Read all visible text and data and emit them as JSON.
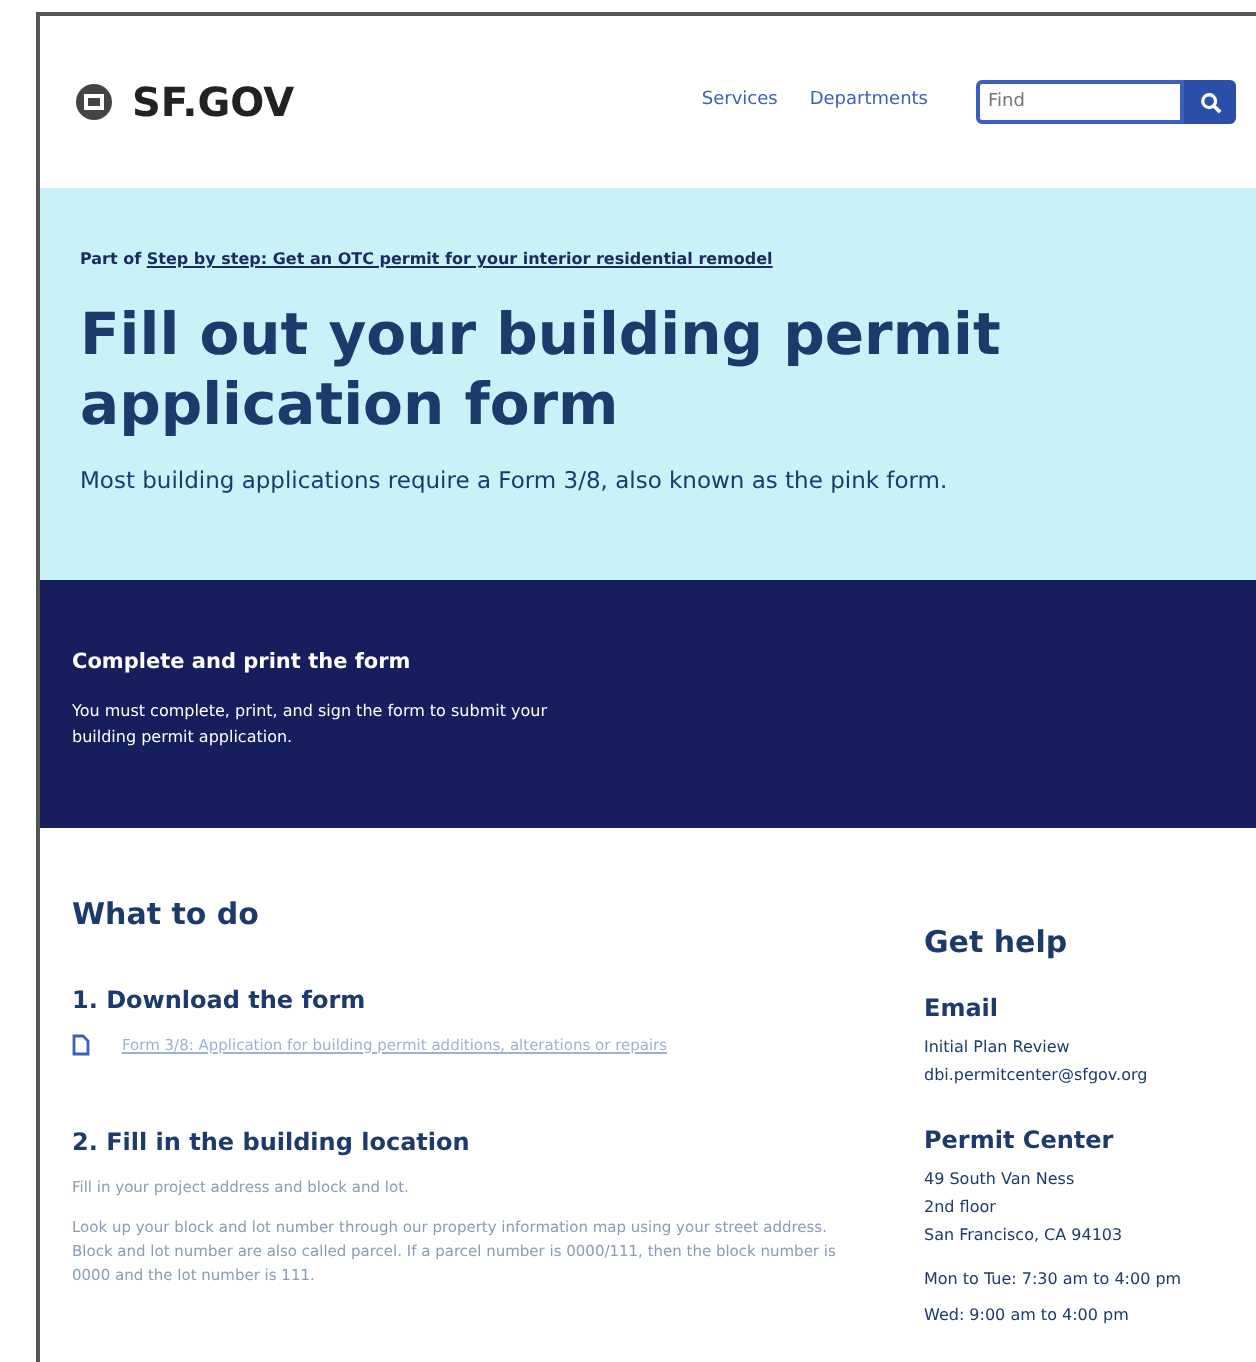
{
  "header": {
    "logo_text": "SF.GOV",
    "nav": [
      "Services",
      "Departments"
    ],
    "search": {
      "placeholder": "Find"
    }
  },
  "hero": {
    "breadcrumb_prefix": "Part of",
    "breadcrumb_link": "Step by step: Get an OTC permit for your interior residential remodel",
    "title": "Fill out your building permit application form",
    "subtitle": "Most building applications require a Form 3/8, also known as the pink form."
  },
  "banner": {
    "title": "Complete and print the form",
    "text": "You must complete, print, and sign the form to submit your building permit application."
  },
  "main": {
    "heading": "What to do",
    "steps": [
      {
        "title": "1. Download the form",
        "kind": "file",
        "link": "Form 3/8: Application for building permit additions, alterations or repairs"
      },
      {
        "title": "2. Fill in the building location",
        "kind": "text",
        "paragraphs": [
          "Fill in your project address and block and lot.",
          "Look up your block and lot number through our property information map using your street address. Block and lot number are also called parcel. If a parcel number is 0000/111, then the block number is 0000 and the lot number is 111."
        ]
      }
    ]
  },
  "help": {
    "heading": "Get help",
    "sections": [
      {
        "title": "Email",
        "lines": [
          "Initial Plan Review",
          "dbi.permitcenter@sfgov.org"
        ]
      },
      {
        "title": "Permit Center",
        "lines": [
          "49 South Van Ness",
          "2nd floor",
          "San Francisco, CA 94103"
        ],
        "hours": [
          "Mon to Tue: 7:30 am to 4:00 pm",
          "Wed: 9:00 am to 4:00 pm"
        ]
      }
    ]
  }
}
